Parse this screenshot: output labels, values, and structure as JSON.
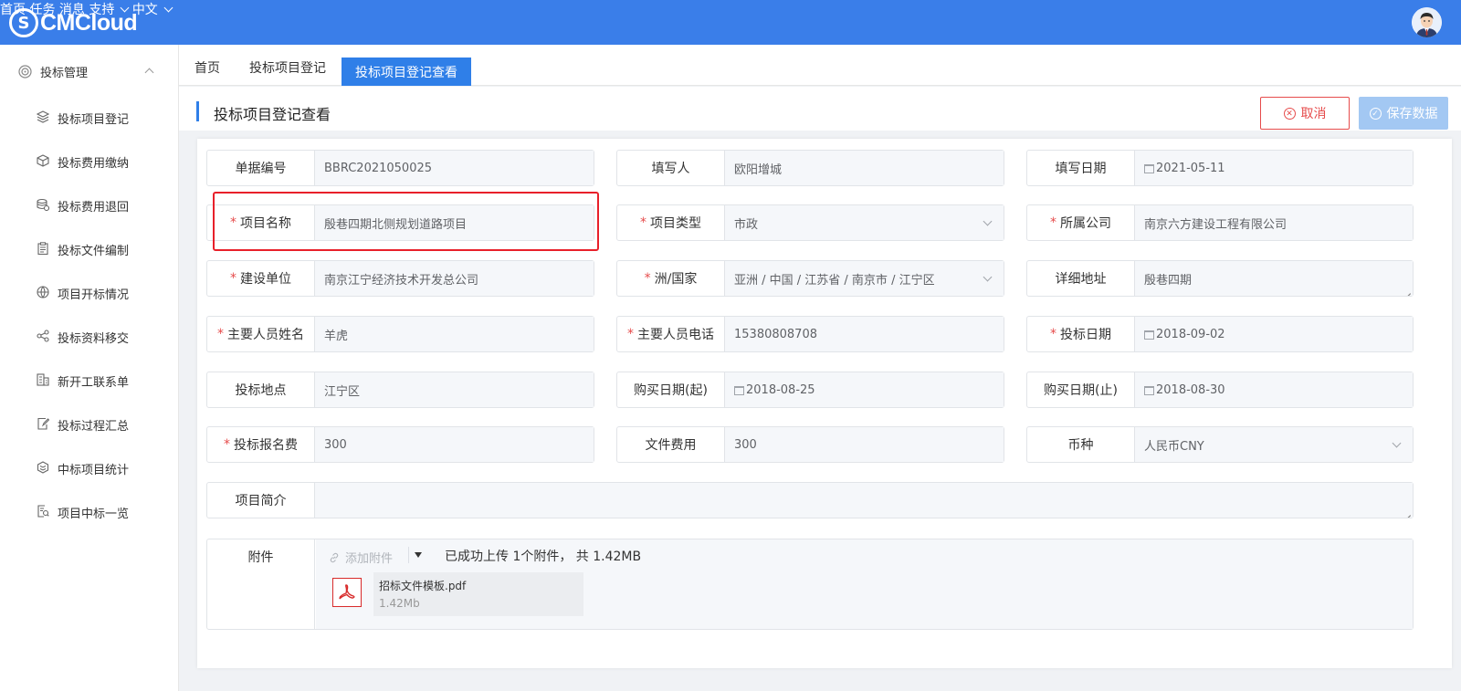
{
  "app": {
    "logo_text": "CMCloud",
    "logo_mark": "S"
  },
  "topnav": {
    "home": "首页",
    "tasks": "任务",
    "messages": "消息",
    "support": "支持",
    "language": "中文"
  },
  "sidebar": {
    "group_label": "投标管理",
    "items": [
      {
        "label": "投标项目登记",
        "icon": "layers-icon"
      },
      {
        "label": "投标费用缴纳",
        "icon": "cube-icon"
      },
      {
        "label": "投标费用退回",
        "icon": "coins-icon"
      },
      {
        "label": "投标文件编制",
        "icon": "clipboard-icon"
      },
      {
        "label": "项目开标情况",
        "icon": "globe-icon"
      },
      {
        "label": "投标资料移交",
        "icon": "share-icon"
      },
      {
        "label": "新开工联系单",
        "icon": "building-icon"
      },
      {
        "label": "投标过程汇总",
        "icon": "edit-doc-icon"
      },
      {
        "label": "中标项目统计",
        "icon": "hexagon-icon"
      },
      {
        "label": "项目中标一览",
        "icon": "doc-search-icon"
      }
    ]
  },
  "tabs": [
    {
      "label": "首页"
    },
    {
      "label": "投标项目登记"
    },
    {
      "label": "投标项目登记查看"
    }
  ],
  "header": {
    "title": "投标项目登记查看",
    "cancel_label": "取消",
    "save_label": "保存数据"
  },
  "form": {
    "doc_no": {
      "label": "单据编号",
      "value": "BBRC2021050025"
    },
    "filler": {
      "label": "填写人",
      "value": "欧阳增城"
    },
    "fill_date": {
      "label": "填写日期",
      "value": "2021-05-11"
    },
    "project_name": {
      "label": "项目名称",
      "value": "殷巷四期北侧规划道路项目"
    },
    "project_type": {
      "label": "项目类型",
      "value": "市政"
    },
    "company": {
      "label": "所属公司",
      "value": "南京六方建设工程有限公司"
    },
    "builder": {
      "label": "建设单位",
      "value": "南京江宁经济技术开发总公司"
    },
    "region": {
      "label": "洲/国家",
      "value": "亚洲 / 中国 / 江苏省 / 南京市 / 江宁区"
    },
    "address": {
      "label": "详细地址",
      "value": "殷巷四期"
    },
    "main_person": {
      "label": "主要人员姓名",
      "value": "羊虎"
    },
    "main_phone": {
      "label": "主要人员电话",
      "value": "15380808708"
    },
    "bid_date": {
      "label": "投标日期",
      "value": "2018-09-02"
    },
    "bid_location": {
      "label": "投标地点",
      "value": "江宁区"
    },
    "buy_start": {
      "label": "购买日期(起)",
      "value": "2018-08-25"
    },
    "buy_end": {
      "label": "购买日期(止)",
      "value": "2018-08-30"
    },
    "reg_fee": {
      "label": "投标报名费",
      "value": "300"
    },
    "file_fee": {
      "label": "文件费用",
      "value": "300"
    },
    "currency": {
      "label": "币种",
      "value": "人民币CNY"
    },
    "summary": {
      "label": "项目简介",
      "value": ""
    },
    "required_mark": "*"
  },
  "attachment": {
    "label": "附件",
    "add_label": "添加附件",
    "status": "已成功上传 1个附件， 共 1.42MB",
    "files": [
      {
        "name": "招标文件模板.pdf",
        "size": "1.42Mb"
      }
    ]
  },
  "colors": {
    "primary": "#3a7ee9",
    "tab_active": "#2f7fe8",
    "danger": "#e64b4b",
    "save_disabled": "#a3c8f3",
    "highlight": "#e8202a"
  }
}
